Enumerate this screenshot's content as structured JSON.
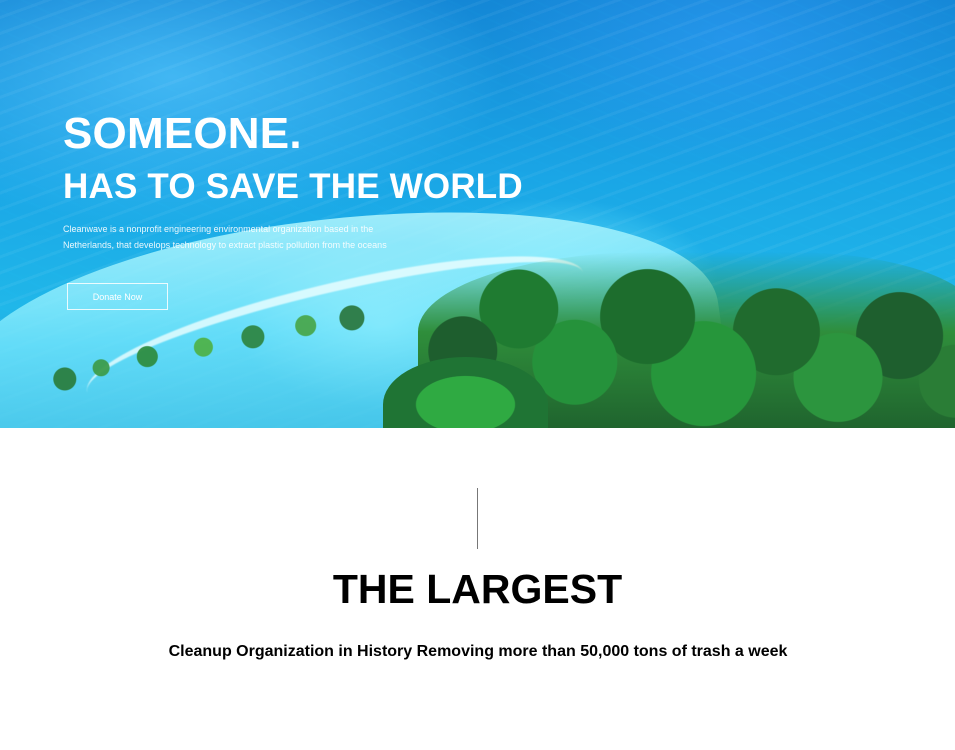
{
  "hero": {
    "title": "SOMEONE.",
    "subtitle": "HAS TO SAVE THE WORLD",
    "description": "Cleanwave is a nonprofit engineering environmental organization based in the Netherlands, that develops technology to extract plastic pollution from the oceans",
    "button_label": "Donate Now"
  },
  "impact": {
    "title": "THE LARGEST",
    "description": "Cleanup Organization in History Removing more than 50,000 tons of trash a week"
  }
}
